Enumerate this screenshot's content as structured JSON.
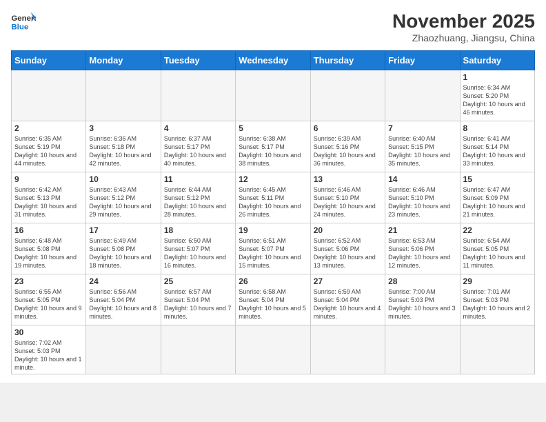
{
  "logo": {
    "text_general": "General",
    "text_blue": "Blue"
  },
  "title": "November 2025",
  "location": "Zhaozhuang, Jiangsu, China",
  "days_of_week": [
    "Sunday",
    "Monday",
    "Tuesday",
    "Wednesday",
    "Thursday",
    "Friday",
    "Saturday"
  ],
  "weeks": [
    [
      {
        "day": "",
        "info": ""
      },
      {
        "day": "",
        "info": ""
      },
      {
        "day": "",
        "info": ""
      },
      {
        "day": "",
        "info": ""
      },
      {
        "day": "",
        "info": ""
      },
      {
        "day": "",
        "info": ""
      },
      {
        "day": "1",
        "info": "Sunrise: 6:34 AM\nSunset: 5:20 PM\nDaylight: 10 hours\nand 46 minutes."
      }
    ],
    [
      {
        "day": "2",
        "info": "Sunrise: 6:35 AM\nSunset: 5:19 PM\nDaylight: 10 hours\nand 44 minutes."
      },
      {
        "day": "3",
        "info": "Sunrise: 6:36 AM\nSunset: 5:18 PM\nDaylight: 10 hours\nand 42 minutes."
      },
      {
        "day": "4",
        "info": "Sunrise: 6:37 AM\nSunset: 5:17 PM\nDaylight: 10 hours\nand 40 minutes."
      },
      {
        "day": "5",
        "info": "Sunrise: 6:38 AM\nSunset: 5:17 PM\nDaylight: 10 hours\nand 38 minutes."
      },
      {
        "day": "6",
        "info": "Sunrise: 6:39 AM\nSunset: 5:16 PM\nDaylight: 10 hours\nand 36 minutes."
      },
      {
        "day": "7",
        "info": "Sunrise: 6:40 AM\nSunset: 5:15 PM\nDaylight: 10 hours\nand 35 minutes."
      },
      {
        "day": "8",
        "info": "Sunrise: 6:41 AM\nSunset: 5:14 PM\nDaylight: 10 hours\nand 33 minutes."
      }
    ],
    [
      {
        "day": "9",
        "info": "Sunrise: 6:42 AM\nSunset: 5:13 PM\nDaylight: 10 hours\nand 31 minutes."
      },
      {
        "day": "10",
        "info": "Sunrise: 6:43 AM\nSunset: 5:12 PM\nDaylight: 10 hours\nand 29 minutes."
      },
      {
        "day": "11",
        "info": "Sunrise: 6:44 AM\nSunset: 5:12 PM\nDaylight: 10 hours\nand 28 minutes."
      },
      {
        "day": "12",
        "info": "Sunrise: 6:45 AM\nSunset: 5:11 PM\nDaylight: 10 hours\nand 26 minutes."
      },
      {
        "day": "13",
        "info": "Sunrise: 6:46 AM\nSunset: 5:10 PM\nDaylight: 10 hours\nand 24 minutes."
      },
      {
        "day": "14",
        "info": "Sunrise: 6:46 AM\nSunset: 5:10 PM\nDaylight: 10 hours\nand 23 minutes."
      },
      {
        "day": "15",
        "info": "Sunrise: 6:47 AM\nSunset: 5:09 PM\nDaylight: 10 hours\nand 21 minutes."
      }
    ],
    [
      {
        "day": "16",
        "info": "Sunrise: 6:48 AM\nSunset: 5:08 PM\nDaylight: 10 hours\nand 19 minutes."
      },
      {
        "day": "17",
        "info": "Sunrise: 6:49 AM\nSunset: 5:08 PM\nDaylight: 10 hours\nand 18 minutes."
      },
      {
        "day": "18",
        "info": "Sunrise: 6:50 AM\nSunset: 5:07 PM\nDaylight: 10 hours\nand 16 minutes."
      },
      {
        "day": "19",
        "info": "Sunrise: 6:51 AM\nSunset: 5:07 PM\nDaylight: 10 hours\nand 15 minutes."
      },
      {
        "day": "20",
        "info": "Sunrise: 6:52 AM\nSunset: 5:06 PM\nDaylight: 10 hours\nand 13 minutes."
      },
      {
        "day": "21",
        "info": "Sunrise: 6:53 AM\nSunset: 5:06 PM\nDaylight: 10 hours\nand 12 minutes."
      },
      {
        "day": "22",
        "info": "Sunrise: 6:54 AM\nSunset: 5:05 PM\nDaylight: 10 hours\nand 11 minutes."
      }
    ],
    [
      {
        "day": "23",
        "info": "Sunrise: 6:55 AM\nSunset: 5:05 PM\nDaylight: 10 hours\nand 9 minutes."
      },
      {
        "day": "24",
        "info": "Sunrise: 6:56 AM\nSunset: 5:04 PM\nDaylight: 10 hours\nand 8 minutes."
      },
      {
        "day": "25",
        "info": "Sunrise: 6:57 AM\nSunset: 5:04 PM\nDaylight: 10 hours\nand 7 minutes."
      },
      {
        "day": "26",
        "info": "Sunrise: 6:58 AM\nSunset: 5:04 PM\nDaylight: 10 hours\nand 5 minutes."
      },
      {
        "day": "27",
        "info": "Sunrise: 6:59 AM\nSunset: 5:04 PM\nDaylight: 10 hours\nand 4 minutes."
      },
      {
        "day": "28",
        "info": "Sunrise: 7:00 AM\nSunset: 5:03 PM\nDaylight: 10 hours\nand 3 minutes."
      },
      {
        "day": "29",
        "info": "Sunrise: 7:01 AM\nSunset: 5:03 PM\nDaylight: 10 hours\nand 2 minutes."
      }
    ],
    [
      {
        "day": "30",
        "info": "Sunrise: 7:02 AM\nSunset: 5:03 PM\nDaylight: 10 hours\nand 1 minute."
      },
      {
        "day": "",
        "info": ""
      },
      {
        "day": "",
        "info": ""
      },
      {
        "day": "",
        "info": ""
      },
      {
        "day": "",
        "info": ""
      },
      {
        "day": "",
        "info": ""
      },
      {
        "day": "",
        "info": ""
      }
    ]
  ]
}
